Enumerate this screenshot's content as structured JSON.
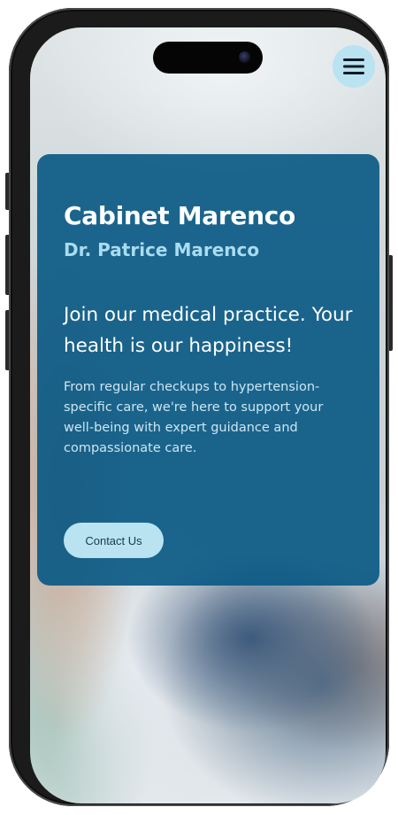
{
  "header": {
    "menu_icon": "hamburger-icon"
  },
  "hero": {
    "title": "Cabinet Marenco",
    "subtitle": "Dr. Patrice Marenco",
    "headline": "Join our medical practice. Your health is our happiness!",
    "description": "From regular checkups to hypertension-specific care, we're here to support your well-being with expert guidance and compassionate care.",
    "cta_label": "Contact Us"
  },
  "colors": {
    "card_background": "#075884",
    "accent": "#b9e3f1",
    "subtitle": "#a9dcef",
    "text": "#ffffff"
  }
}
